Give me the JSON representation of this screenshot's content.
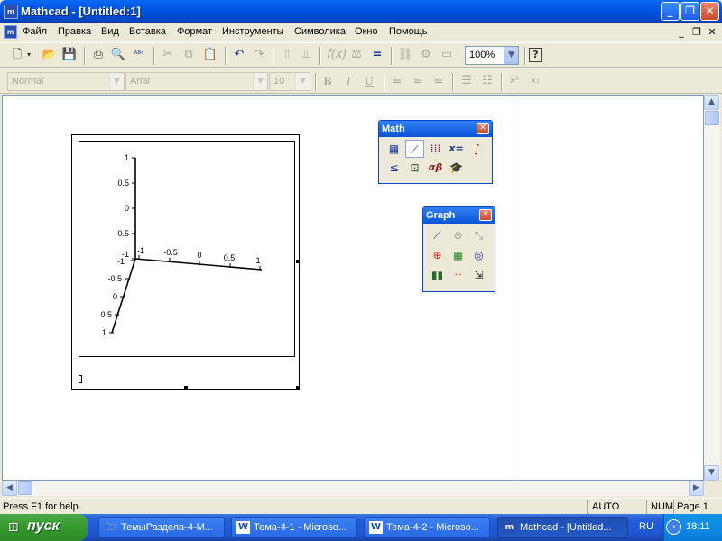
{
  "window": {
    "title": "Mathcad - [Untitled:1]",
    "app_icon": "m",
    "controls": {
      "minimize": "_",
      "maximize": "❐",
      "close": "✕"
    }
  },
  "menu": {
    "items": [
      "Файл",
      "Правка",
      "Вид",
      "Вставка",
      "Формат",
      "Инструменты",
      "Символика",
      "Окно",
      "Помощь"
    ],
    "doc_controls": {
      "minimize": "_",
      "restore": "❐",
      "close": "✕"
    }
  },
  "toolbar": {
    "zoom": "100%",
    "help_icon": "?"
  },
  "format_toolbar": {
    "style": "Normal",
    "font": "Arial",
    "size": "10",
    "bold": "B",
    "italic": "I",
    "underline": "U",
    "superscript": "x²",
    "subscript": "x₂"
  },
  "plot": {
    "z_ticks": [
      "1",
      "0.5",
      "0",
      "-0.5",
      "-1"
    ],
    "x_ticks": [
      "-1",
      "-0.5",
      "0",
      "0.5",
      "1"
    ],
    "y_ticks": [
      "-1",
      "-0.5",
      "0",
      "0.5",
      "1"
    ]
  },
  "math_palette": {
    "title": "Math",
    "close": "✕",
    "buttons": [
      "calculator-icon",
      "graph-icon",
      "matrix-icon",
      "evaluation-icon",
      "calculus-icon",
      "boolean-icon",
      "programming-icon",
      "greek-icon",
      "symbolic-icon"
    ],
    "eval_label": "x=",
    "greek_label": "αβ"
  },
  "graph_palette": {
    "title": "Graph",
    "close": "✕",
    "buttons": [
      "xy-plot-icon",
      "polar-plot-icon",
      "zoom-icon",
      "surface-plot-icon",
      "contour-plot-icon",
      "trace-icon",
      "bar-plot-icon",
      "scatter-plot-icon",
      "vector-field-icon"
    ]
  },
  "status": {
    "help": "Press F1 for help.",
    "mode": "AUTO",
    "num": "NUM",
    "page": "Page 1"
  },
  "taskbar": {
    "start": "пуск",
    "tasks": [
      {
        "label": "ТемыРаздела-4-М...",
        "icon": "folder-icon",
        "active": false
      },
      {
        "label": "Тема-4-1 - Microso...",
        "icon": "word-icon",
        "active": false
      },
      {
        "label": "Тема-4-2 - Microso...",
        "icon": "word-icon",
        "active": false
      },
      {
        "label": "Mathcad - [Untitled...",
        "icon": "mathcad-icon",
        "active": true
      }
    ],
    "language": "RU",
    "clock": "18:11"
  }
}
